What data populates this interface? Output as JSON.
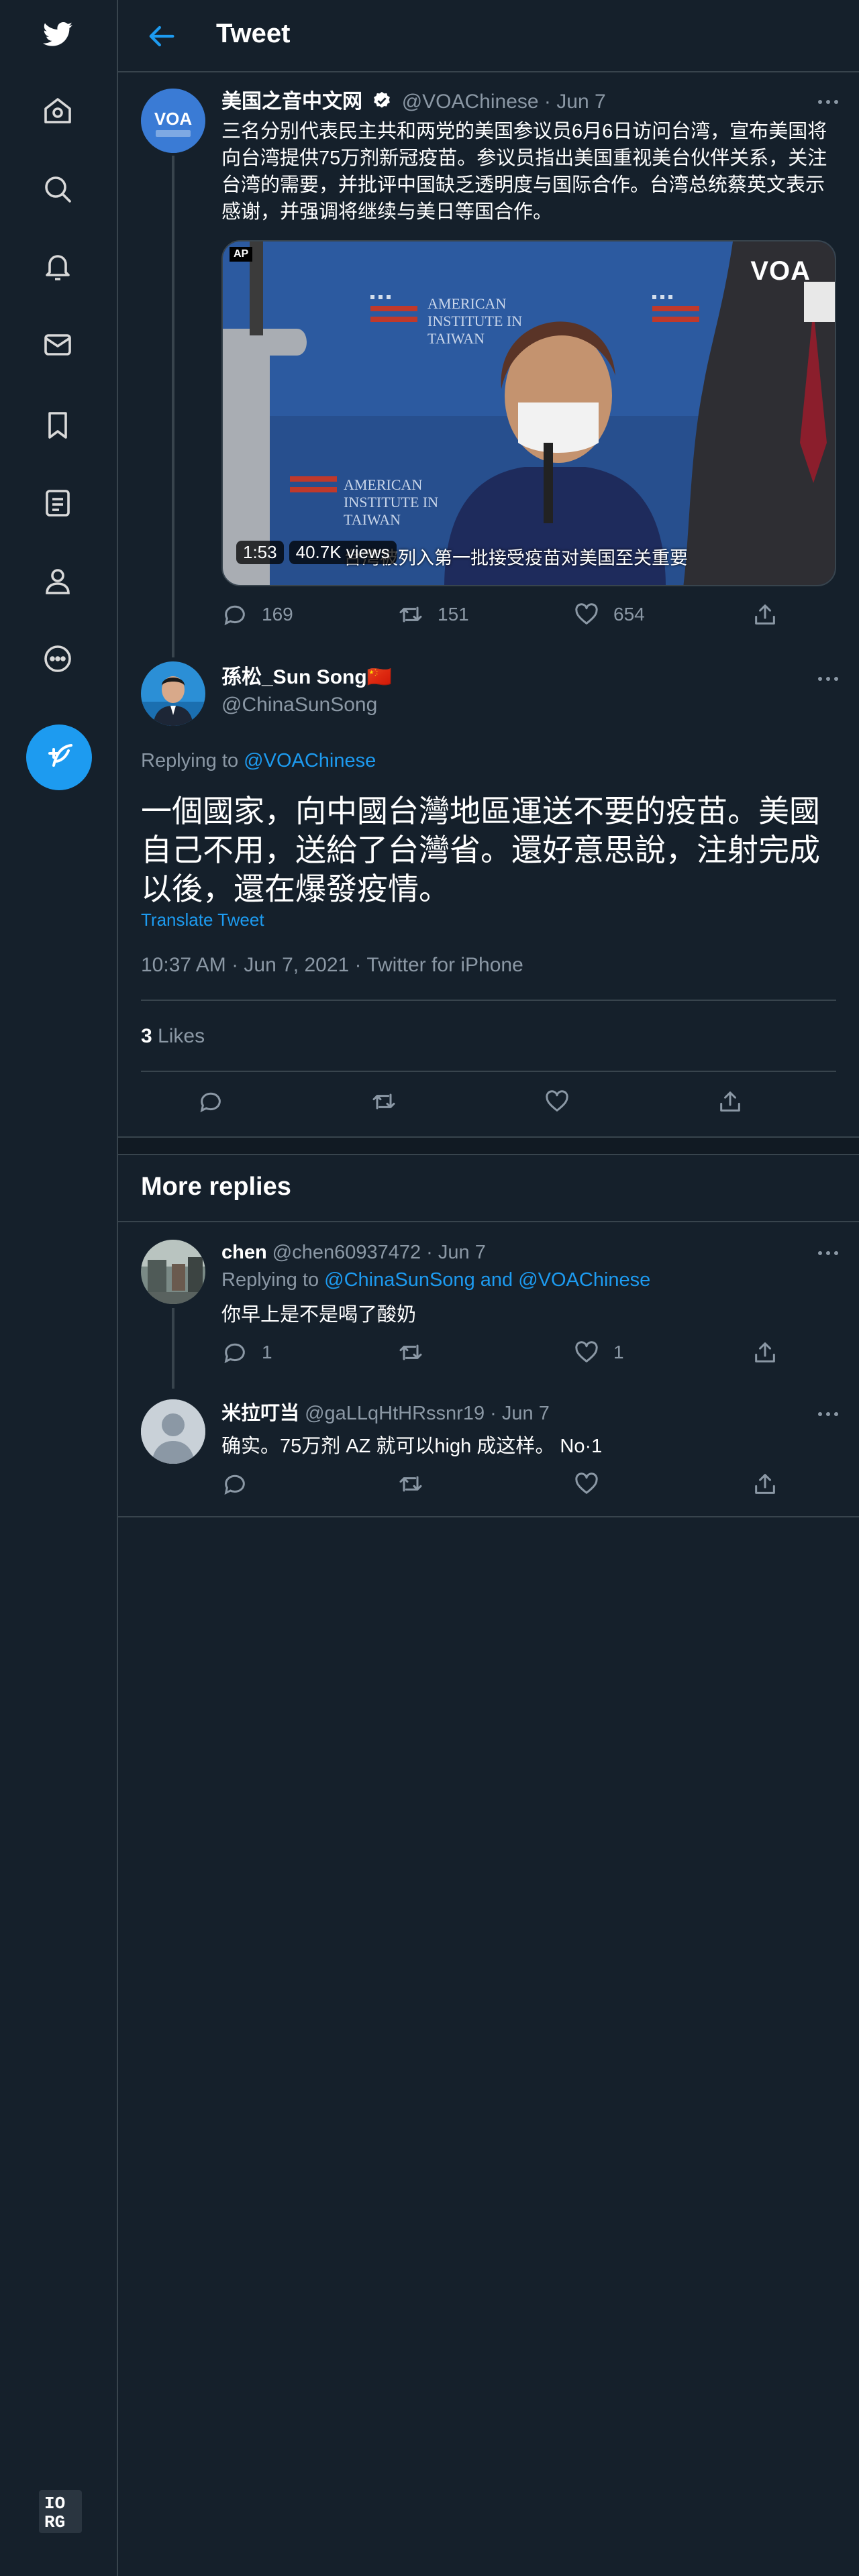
{
  "header": {
    "title": "Tweet"
  },
  "sidebar": {
    "items": [
      {
        "icon": "twitter-logo-icon"
      },
      {
        "icon": "home-icon"
      },
      {
        "icon": "search-icon"
      },
      {
        "icon": "bell-icon"
      },
      {
        "icon": "mail-icon"
      },
      {
        "icon": "bookmark-icon"
      },
      {
        "icon": "list-icon"
      },
      {
        "icon": "profile-icon"
      },
      {
        "icon": "more-circle-icon"
      }
    ],
    "compose_icon": "feather-plus-icon",
    "footer_logo_line1": "IO",
    "footer_logo_line2": "RG"
  },
  "original_tweet": {
    "name": "美国之音中文网",
    "verified": true,
    "handle": "@VOAChinese",
    "sep": "·",
    "time": "Jun 7",
    "text": "三名分别代表民主共和两党的美国参议员6月6日访问台湾，宣布美国将向台湾提供75万剂新冠疫苗。参议员指出美国重视美台伙伴关系，关注台湾的需要，并批评中国缺乏透明度与国际合作。台湾总统蔡英文表示感谢，并强调将继续与美日等国合作。",
    "video": {
      "duration": "1:53",
      "views": "40.7K views",
      "caption": "台湾被列入第一批接受疫苗对美国至关重要",
      "corner_tag": "AP",
      "watermark": "VOA",
      "banner_lines": [
        "AMERICAN",
        "INSTITUTE IN",
        "TAIWAN"
      ]
    },
    "replies": "169",
    "retweets": "151",
    "likes": "654"
  },
  "main_tweet": {
    "name": "孫松_Sun Song",
    "flag": "🇨🇳",
    "handle": "@ChinaSunSong",
    "replying_prefix": "Replying to",
    "replying_to": "@VOAChinese",
    "text": "一個國家，向中國台灣地區運送不要的疫苗。美國自己不用，送給了台灣省。還好意思說，注射完成以後，還在爆發疫情。",
    "translate": "Translate Tweet",
    "timestamp": "10:37 AM · Jun 7, 2021 · Twitter for iPhone",
    "likes_count": "3",
    "likes_label": "Likes"
  },
  "more_replies": {
    "title": "More replies",
    "items": [
      {
        "name": "chen",
        "handle": "@chen60937472",
        "sep": "·",
        "time": "Jun 7",
        "replying_prefix": "Replying to",
        "replying_to": "@ChinaSunSong and @VOAChinese",
        "text": "你早上是不是喝了酸奶",
        "replies": "1",
        "retweets": "",
        "likes": "1"
      },
      {
        "name": "米拉叮当",
        "handle": "@gaLLqHtHRssnr19",
        "sep": "·",
        "time": "Jun 7",
        "text": "确实。75万剂 AZ 就可以high 成这样。 No·1",
        "replies": "",
        "retweets": "",
        "likes": ""
      }
    ]
  },
  "colors": {
    "background": "#15202b",
    "accent": "#1d9bf0",
    "border": "#38444d",
    "muted": "#8b98a5"
  }
}
